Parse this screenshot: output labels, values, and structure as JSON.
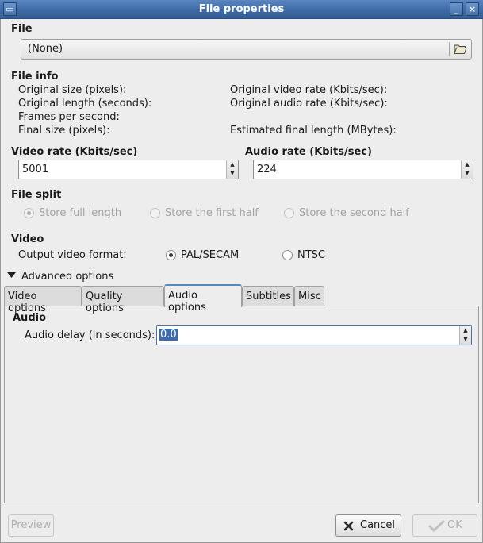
{
  "window": {
    "title": "File properties"
  },
  "file": {
    "heading": "File",
    "value": "(None)",
    "open_icon": "folder-open-icon"
  },
  "file_info": {
    "heading": "File info",
    "original_size": "Original size (pixels):",
    "original_length": "Original length (seconds):",
    "fps": "Frames per second:",
    "final_size": "Final size (pixels):",
    "original_video_rate": "Original video rate (Kbits/sec):",
    "original_audio_rate": "Original audio rate (Kbits/sec):",
    "estimated_length": "Estimated final length (MBytes):"
  },
  "video_rate": {
    "label": "Video rate (Kbits/sec)",
    "value": "5001"
  },
  "audio_rate": {
    "label": "Audio rate (Kbits/sec)",
    "value": "224"
  },
  "file_split": {
    "heading": "File split",
    "options": [
      "Store full length",
      "Store the first half",
      "Store the second half"
    ],
    "selected": "Store full length"
  },
  "video": {
    "heading": "Video",
    "format_label": "Output video format:",
    "options": [
      "PAL/SECAM",
      "NTSC"
    ],
    "selected": "PAL/SECAM"
  },
  "advanced": {
    "label": "Advanced options",
    "tabs": [
      "Video options",
      "Quality options",
      "Audio options",
      "Subtitles",
      "Misc"
    ],
    "active_tab": "Audio options"
  },
  "audio_panel": {
    "heading": "Audio",
    "delay_label": "Audio delay (in seconds):",
    "delay_value": "0.0"
  },
  "buttons": {
    "preview": "Preview",
    "cancel": "Cancel",
    "ok": "OK"
  }
}
